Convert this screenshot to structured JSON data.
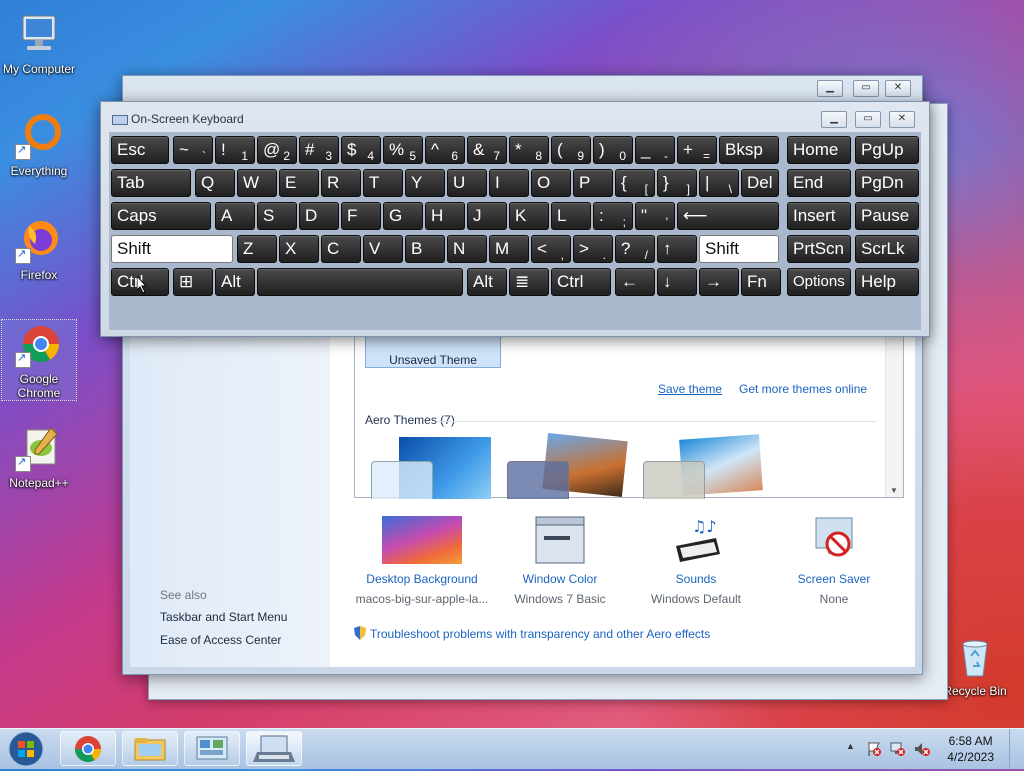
{
  "desktop": {
    "icons": [
      {
        "label": "My Computer"
      },
      {
        "label": "Everything"
      },
      {
        "label": "Firefox"
      },
      {
        "label": "Google Chrome"
      },
      {
        "label": "Notepad++"
      },
      {
        "label": "Recycle Bin"
      }
    ]
  },
  "osk": {
    "title": "On-Screen Keyboard",
    "rows": [
      [
        "Esc",
        "~ `",
        "! 1",
        "@ 2",
        "# 3",
        "$ 4",
        "% 5",
        "^ 6",
        "& 7",
        "* 8",
        "( 9",
        ") 0",
        "_ -",
        "+ =",
        "Bksp",
        "Home",
        "PgUp"
      ],
      [
        "Tab",
        "Q",
        "W",
        "E",
        "R",
        "T",
        "Y",
        "U",
        "I",
        "O",
        "P",
        "{ [",
        "} ]",
        "| \\",
        "Del",
        "End",
        "PgDn"
      ],
      [
        "Caps",
        "A",
        "S",
        "D",
        "F",
        "G",
        "H",
        "J",
        "K",
        "L",
        ": ;",
        "\" '",
        "⟵",
        "Insert",
        "Pause"
      ],
      [
        "Shift",
        "Z",
        "X",
        "C",
        "V",
        "B",
        "N",
        "M",
        "< ,",
        "> .",
        "? /",
        "↑",
        "Shift",
        "PrtScn",
        "ScrLk"
      ],
      [
        "Ctrl",
        "⊞",
        "Alt",
        "",
        "Alt",
        "≣",
        "Ctrl",
        "←",
        "↓",
        "→",
        "Fn",
        "Options",
        "Help"
      ]
    ]
  },
  "personalization": {
    "unsaved_theme": "Unsaved Theme",
    "save_theme": "Save theme",
    "get_more": "Get more themes online",
    "aero_header": "Aero Themes (7)",
    "see_also": "See also",
    "left_links": [
      "Taskbar and Start Menu",
      "Ease of Access Center"
    ],
    "bottom": [
      {
        "title": "Desktop Background",
        "sub": "macos-big-sur-apple-la..."
      },
      {
        "title": "Window Color",
        "sub": "Windows 7 Basic"
      },
      {
        "title": "Sounds",
        "sub": "Windows Default"
      },
      {
        "title": "Screen Saver",
        "sub": "None"
      }
    ],
    "troubleshoot": "Troubleshoot problems with transparency and other Aero effects"
  },
  "taskbar": {
    "time": "6:58 AM",
    "date": "4/2/2023"
  },
  "colors": {
    "key_bg": "#2b2b2b",
    "keyboard_bg": "#a9b8cd",
    "link": "#1a64c2"
  }
}
